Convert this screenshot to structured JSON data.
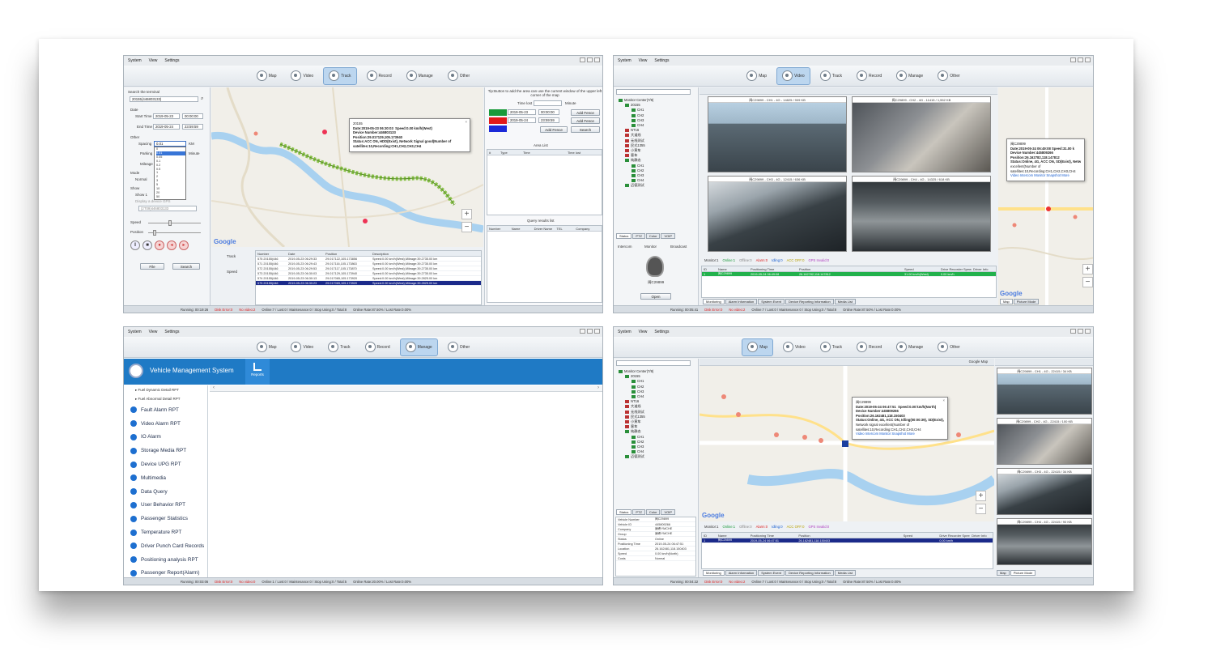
{
  "menu": {
    "system": "System",
    "view": "View",
    "settings": "Settings"
  },
  "tools": {
    "map": "Map",
    "video": "Video",
    "track": "Track",
    "record": "Record",
    "manage": "Manage",
    "other": "Other"
  },
  "track": {
    "search_terminal": "Search the terminal",
    "terminal_value": "20155(446803133)",
    "date": "Date",
    "start_time": "Start Time",
    "start_date": "2019-05-23",
    "start_clock": "00:00:00",
    "end_time": "End Time",
    "end_date": "2019-05-24",
    "end_clock": "23:59:59",
    "other": "Other",
    "spacing": "Spacing",
    "spacing_value": "0.01",
    "unit_km": "KM",
    "parking": "Parking",
    "minute": "Minute",
    "mileage": "Mileage",
    "mode": "Mode",
    "normal": "Normal",
    "show": "Show",
    "show1": "Show 1",
    "display_device": "Display a device GPS",
    "device_select": "(2T09)446803133",
    "speed": "Speed",
    "position": "Position",
    "file": "File",
    "search": "Search",
    "spacing_options": [
      "0",
      "0.01",
      "0.05",
      "0.1",
      "0.2",
      "0.5",
      "1",
      "2",
      "3",
      "5",
      "10",
      "20",
      "50"
    ],
    "tip": "Tip:Button to add the area can use the current window of the upper left corner of the map",
    "time_lost": "Time lost",
    "add_fence": "Add Fence",
    "search_btn": "Search",
    "area_list": "Area List",
    "area_cols": [
      "#",
      "Type",
      "Time",
      "Time lost"
    ],
    "query_results": "Query results list",
    "query_cols": [
      "Number",
      "Name",
      "Driver Name",
      "TEL",
      "Company"
    ],
    "popup": {
      "title": "20155",
      "date": "Date:2019-05-23 06:30:03",
      "speed": "Speed:0.00 km/h(West)",
      "device": "Device Number:446803133",
      "position": "Position:29.017129,105.173940",
      "status": "Status:ACC ON, HDD(Exist), Network Signal good(Number of satellites:10,Recording:CH1,CH2,CH3,CH4"
    },
    "track_label": "Track",
    "speed_label": "Speed",
    "table_cols": [
      "Number",
      "Date",
      "Position",
      "Description"
    ],
    "rows": [
      [
        "575 20155(446",
        "2019-05-23 06:29:33",
        "29.017122,105.173856",
        "Speed:0.00 km/h(West),Mileage:39.2735.00 km"
      ],
      [
        "571 20155(446",
        "2019-05-23 06:29:43",
        "29.017116,105.173863",
        "Speed:0.00 km/h(West),Mileage:39.2735.00 km"
      ],
      [
        "572 20155(446",
        "2019-05-23 06:29:53",
        "29.017117,105.173870",
        "Speed:0.00 km/h(West),Mileage:39.2735.00 km"
      ],
      [
        "573 20155(446",
        "2019-05-23 06:30:03",
        "29.017129,105.173940",
        "Speed:0.00 km/h(West),Mileage:39.2735.00 km"
      ],
      [
        "574 20155(446",
        "2019-05-23 06:30:13",
        "29.017065,105.173920",
        "Speed:0.00 km/h(West),Mileage:39.2825.00 km"
      ],
      [
        "575 20155(446",
        "2019-05-23 06:30:23",
        "29.017065,105.173920",
        "Speed:0.00 km/h(West),Mileage:39.2825.00 km"
      ]
    ],
    "status": {
      "running": "Running: 00:19:26",
      "disk": "Disk Error:0",
      "novideo": "No video:2",
      "online": "Online:7 / Lost:0 / Maintenance:0 / Stop Using:0 / Total:8",
      "rate": "Online Rate:87.50% / Lost Rate:0.00%"
    }
  },
  "video": {
    "monitor_center": "Monitor Center(7/8)",
    "tree": [
      "20155",
      "CH1",
      "CH2",
      "CH3",
      "CH4",
      "NT16",
      "大道线",
      "无线测试",
      "民式1355",
      "小黄车",
      "客车",
      "纯静态",
      "CH1",
      "CH2",
      "CH3",
      "CH4",
      "迈德测试"
    ],
    "cams": [
      "闽C29899 - CH1 - 4G - 14825 / 909 KB",
      "闽C29899 - CH2 - 4G - 11415 / 1,552 KB",
      "闽C29899 - CH3 - 4G - 12415 / 636 KB",
      "闽C29899 - CH4 - 4G - 14325 / 618 KB"
    ],
    "tabs": [
      "Status",
      "PTZ",
      "Color",
      "VOIP"
    ],
    "intercom": "Intercom",
    "monitor": "Monitor",
    "broadcast": "Broadcast",
    "open": "Open",
    "plate": "闽C29899",
    "monitor_line": "Monitor:1",
    "online": "Online:1",
    "offline": "Offline:0",
    "alarm": "Alarm:0",
    "idling": "Idling:0",
    "acc_off": "ACC OFF:0",
    "gps_invalid": "GPS Invalid:0",
    "cols": [
      "ID",
      "Name",
      "Positioning Time",
      "Position",
      "Speed",
      "Drive Recorder Speed",
      "Driver Info"
    ],
    "row": [
      "1",
      "闽C29899",
      "2019-05-24 06:49:08",
      "26.162782,118.147812",
      "31.00 km/h(West)",
      "0.00 km/h",
      ""
    ],
    "bottom_tabs": [
      "Monitoring",
      "Alarm Information",
      "System Event",
      "Device Reporting Information",
      "Media List"
    ],
    "popup": {
      "title": "闽C29899",
      "date": "Date:2019-05-24 06:49:08",
      "speed": "Speed:31.00 k",
      "device": "Device Number:445809266",
      "position": "Position:26.162782,118.147812",
      "status": "Status:Online, 4G, ACC ON, SD(Exist), Netw",
      "status2": "excellent(Number of",
      "status3": "satellites:10,Recording:CH1,CH2,CH3,CH4",
      "links": "Video Intercom Monitor Snapshot More"
    },
    "map_mode": "Map",
    "picture_mode": "Picture Mode",
    "status": {
      "running": "Running: 00:05:41",
      "disk": "Disk Error:0",
      "novideo": "No video:2",
      "online": "Online:7 / Lost:0 / Maintenance:0 / Stop Using:0 / Total:8",
      "rate": "Online Rate:87.50% / Lost Rate:0.00%"
    }
  },
  "manage": {
    "title": "Vehicle Management System",
    "reports": "Reports",
    "subitems": [
      "Fuel Dynamic Detail RPT",
      "Fuel Abnormal Detail RPT"
    ],
    "items": [
      "Fault Alarm RPT",
      "Video Alarm RPT",
      "IO Alarm",
      "Storage Media RPT",
      "Device UPG RPT",
      "Multimedia",
      "Data Query",
      "User Behavior RPT",
      "Passenger Statistics",
      "Temperature RPT",
      "Driver Punch Card Records",
      "Positioning analysis RPT",
      "Passenger Report(Alarm)"
    ],
    "status": {
      "running": "Running: 00:03:06",
      "disk": "Disk Error:0",
      "novideo": "No video:0",
      "online": "Online:1 / Lost:0 / Maintenance:0 / Stop Using:0 / Total:5",
      "rate": "Online Rate:20.00% / Lost Rate:0.00%"
    }
  },
  "map": {
    "map_select": "Google Map",
    "tree_info": [
      [
        "Vehicle Number",
        "闽C29899"
      ],
      [
        "Vehicle ID",
        "445809266"
      ],
      [
        "Company",
        "康希YMCHE"
      ],
      [
        "Group",
        "康希YMCHE"
      ],
      [
        "Status",
        "Online"
      ],
      [
        "Positioning Time",
        "2019-05-24 06:47:51"
      ],
      [
        "Location",
        "26.162481,118.150403"
      ],
      [
        "Speed",
        "0.00 km/h(North)"
      ],
      [
        "Costs",
        "Normal"
      ]
    ],
    "popup": {
      "title": "闽C29899",
      "date": "Date:2019-05-24 06:47:51",
      "speed": "Speed:0.00 km/h(North)",
      "device": "Device Number:445809266",
      "position": "Position:26.162481,118.150403",
      "status": "Status:Online, 4G, ACC ON, Idling(00:00:39), SD(Exist),",
      "status2": "Network signal excellent(Number of",
      "status3": "satellites:10,Recording:CH1,CH2,CH3,CH4",
      "links": "Video Intercom Monitor Snapshot More"
    },
    "row": [
      "1",
      "闽C29899",
      "2019-05-24 06:47:51",
      "26.162481,118.150403",
      "",
      "0.00 km/h",
      ""
    ],
    "pics": [
      "闽C29899 - CH1 - 4G - 22415 / 34 KB",
      "闽C29899 - CH2 - 4G - 22415 / 100 KB",
      "闽C29899 - CH3 - 4G - 22415 / 34 KB",
      "闽C29899 - CH4 - 4G - 22415 / 90 KB"
    ],
    "status": {
      "running": "Running: 00:04:22",
      "disk": "Disk Error:0",
      "novideo": "No video:2",
      "online": "Online:7 / Lost:0 / Maintenance:0 / Stop Using:0 / Total:8",
      "rate": "Online Rate:87.50% / Lost Rate:0.00%"
    }
  }
}
